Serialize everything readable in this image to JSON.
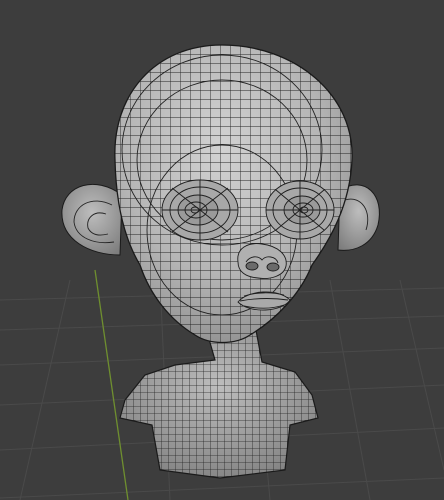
{
  "viewport": {
    "background": "#3d3d3d",
    "grid_color": "#4a4a4a",
    "y_axis_color": "#6f8f2f"
  },
  "model": {
    "icon": "wireframe-head-bust",
    "surface_color": "#b9b9b9",
    "wire_color": "#1e1e1e"
  }
}
